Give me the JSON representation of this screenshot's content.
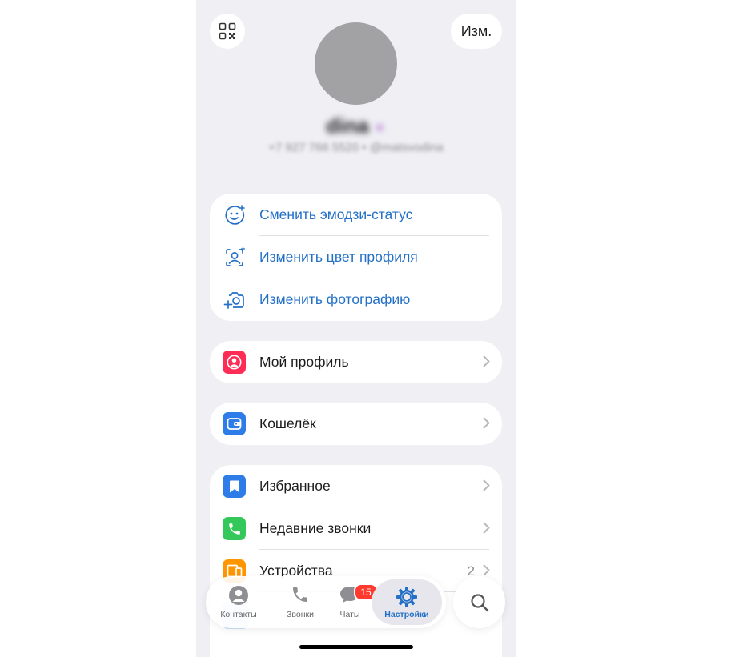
{
  "header": {
    "edit_label": "Изм.",
    "name": "dina",
    "subtitle": "+7 927 766 5520 • @matsvodina"
  },
  "actions": [
    {
      "label": "Сменить эмодзи-статус",
      "icon": "emoji-status-icon"
    },
    {
      "label": "Изменить цвет профиля",
      "icon": "profile-color-icon"
    },
    {
      "label": "Изменить фотографию",
      "icon": "camera-plus-icon"
    }
  ],
  "profile_row": {
    "label": "Мой профиль",
    "icon": "person-icon",
    "color": "#ff2d55"
  },
  "wallet_row": {
    "label": "Кошелёк",
    "icon": "wallet-icon",
    "color": "#2e7ce8"
  },
  "settings_rows": [
    {
      "label": "Избранное",
      "icon": "bookmark-icon",
      "color": "#2e7ce8",
      "count": ""
    },
    {
      "label": "Недавние звонки",
      "icon": "phone-icon",
      "color": "#34c759",
      "count": ""
    },
    {
      "label": "Устройства",
      "icon": "devices-icon",
      "color": "#ff9500",
      "count": "2"
    }
  ],
  "tabbar": {
    "contacts": "Контакты",
    "calls": "Звонки",
    "chats": "Чаты",
    "chats_badge": "15",
    "settings": "Настройки",
    "active": "settings"
  },
  "colors": {
    "accent": "#2370c6",
    "background": "#efeff4"
  }
}
